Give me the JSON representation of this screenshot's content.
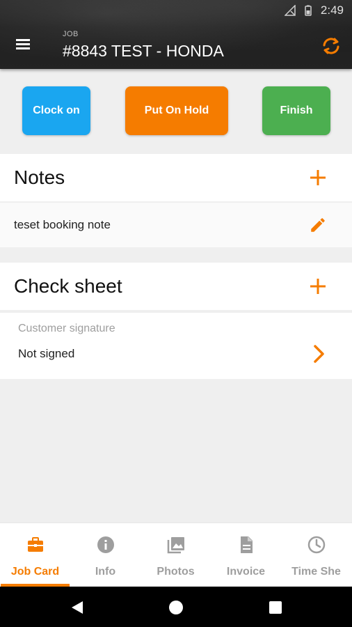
{
  "status_bar": {
    "time": "2:49"
  },
  "header": {
    "caption": "JOB",
    "title": "#8843 TEST - HONDA",
    "menu_icon": "hamburger-menu-icon",
    "sync_icon": "sync-icon"
  },
  "actions": {
    "clock_on": "Clock on",
    "put_on_hold": "Put On Hold",
    "finish": "Finish"
  },
  "notes": {
    "title": "Notes",
    "items": [
      {
        "text": "teset booking note"
      }
    ]
  },
  "check_sheet": {
    "title": "Check sheet",
    "signature_label": "Customer signature",
    "signature_value": "Not signed"
  },
  "tabs": [
    {
      "label": "Job Card",
      "icon": "briefcase-icon",
      "active": true
    },
    {
      "label": "Info",
      "icon": "info-icon",
      "active": false
    },
    {
      "label": "Photos",
      "icon": "photos-icon",
      "active": false
    },
    {
      "label": "Invoice",
      "icon": "invoice-icon",
      "active": false
    },
    {
      "label": "Time She",
      "icon": "clock-icon",
      "active": false
    }
  ],
  "colors": {
    "accent": "#f57c00",
    "clock_on": "#1aa6f0",
    "put_on_hold": "#f57c00",
    "finish": "#4caf50"
  }
}
